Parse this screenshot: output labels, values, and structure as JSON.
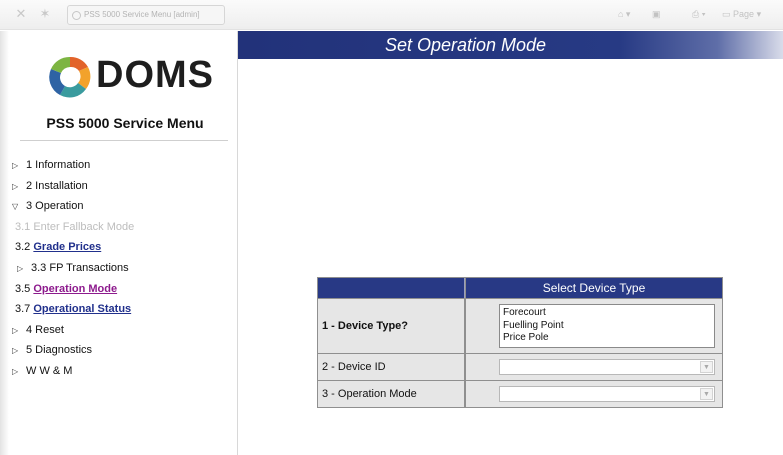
{
  "browser": {
    "tab_title": "PSS 5000 Service Menu [admin]",
    "page_menu_label": "Page",
    "brand_color": "#283985"
  },
  "sidebar": {
    "logo_text": "DOMS",
    "menu_title": "PSS 5000 Service Menu",
    "items": [
      {
        "label": "1 Information"
      },
      {
        "label": "2 Installation"
      },
      {
        "label": "3 Operation"
      },
      {
        "label": "3.1 Enter Fallback Mode"
      },
      {
        "prefix": "3.2 ",
        "link": "Grade Prices"
      },
      {
        "label": "3.3 FP Transactions"
      },
      {
        "prefix": "3.5 ",
        "link": "Operation Mode"
      },
      {
        "prefix": "3.7 ",
        "link": "Operational Status"
      },
      {
        "label": "4 Reset"
      },
      {
        "label": "5 Diagnostics"
      },
      {
        "label": "W W & M"
      }
    ]
  },
  "main": {
    "title": "Set Operation Mode",
    "form": {
      "header": "Select Device Type",
      "rows": [
        {
          "label": "1 - Device Type?",
          "options": [
            "Forecourt",
            "Fuelling Point",
            "Price Pole"
          ]
        },
        {
          "label": "2 - Device ID",
          "value": ""
        },
        {
          "label": "3 - Operation Mode",
          "value": ""
        }
      ]
    }
  }
}
